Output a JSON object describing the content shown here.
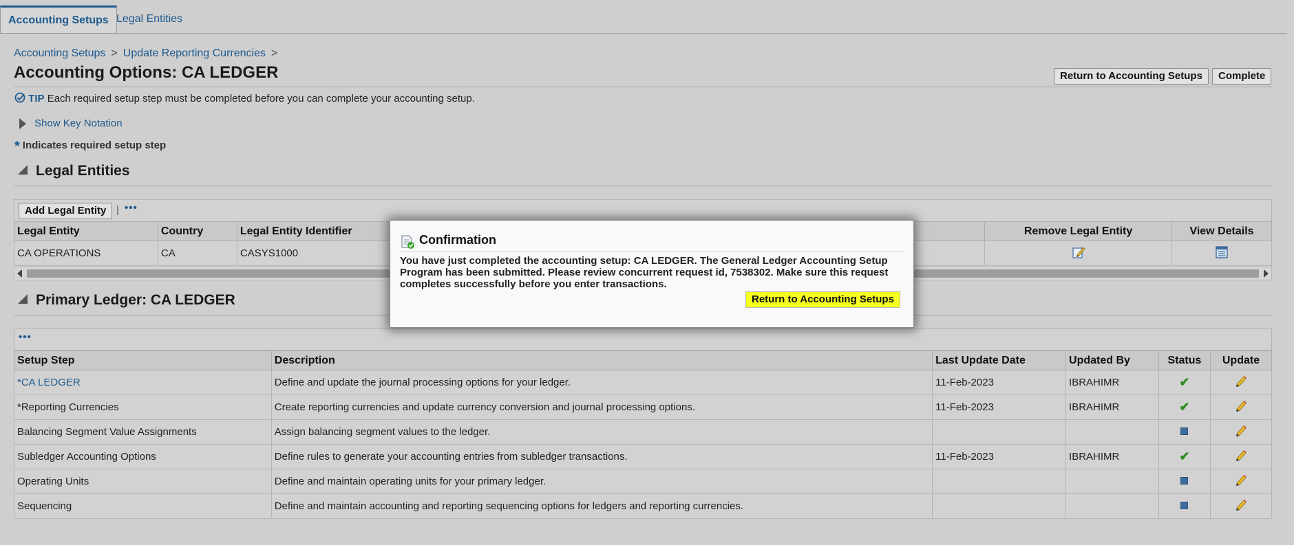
{
  "tabs": [
    {
      "label": "Accounting Setups",
      "active": true
    },
    {
      "label": "Legal Entities",
      "active": false
    }
  ],
  "breadcrumb": {
    "items": [
      "Accounting Setups",
      "Update Reporting Currencies"
    ],
    "separator": ">"
  },
  "page_title": "Accounting Options: CA LEDGER",
  "header_buttons": {
    "return": "Return to Accounting Setups",
    "complete": "Complete"
  },
  "tip": {
    "label": "TIP",
    "text": "Each required setup step must be completed before you can complete your accounting setup."
  },
  "key_notation": "Show Key Notation",
  "required_note": {
    "star": "*",
    "text": "Indicates required setup step"
  },
  "legal_entities": {
    "section_title": "Legal Entities",
    "add_button": "Add Legal Entity",
    "separator": "|",
    "more_icon": "•••",
    "columns": [
      "Legal Entity",
      "Country",
      "Legal Entity Identifier",
      "Remove Legal Entity",
      "View Details"
    ],
    "rows": [
      {
        "entity": "CA OPERATIONS",
        "country": "CA",
        "identifier": "CASYS1000"
      }
    ]
  },
  "primary_ledger": {
    "section_title": "Primary Ledger: CA LEDGER",
    "more_icon": "•••",
    "columns": [
      "Setup Step",
      "Description",
      "Last Update Date",
      "Updated By",
      "Status",
      "Update"
    ],
    "rows": [
      {
        "step": "*CA LEDGER",
        "link": true,
        "description": "Define and update the journal processing options for your ledger.",
        "date": "11-Feb-2023",
        "by": "IBRAHIMR",
        "status": "complete"
      },
      {
        "step": "*Reporting Currencies",
        "link": false,
        "description": "Create reporting currencies and update currency conversion and journal processing options.",
        "date": "11-Feb-2023",
        "by": "IBRAHIMR",
        "status": "complete"
      },
      {
        "step": "Balancing Segment Value Assignments",
        "link": false,
        "description": "Assign balancing segment values to the ledger.",
        "date": "",
        "by": "",
        "status": "not-started"
      },
      {
        "step": "Subledger Accounting Options",
        "link": false,
        "description": "Define rules to generate your accounting entries from subledger transactions.",
        "date": "11-Feb-2023",
        "by": "IBRAHIMR",
        "status": "complete"
      },
      {
        "step": "Operating Units",
        "link": false,
        "description": "Define and maintain operating units for your primary ledger.",
        "date": "",
        "by": "",
        "status": "not-started"
      },
      {
        "step": "Sequencing",
        "link": false,
        "description": "Define and maintain accounting and reporting sequencing options for ledgers and reporting currencies.",
        "date": "",
        "by": "",
        "status": "not-started"
      }
    ]
  },
  "confirmation": {
    "title": "Confirmation",
    "message": "You have just completed the accounting setup: CA LEDGER. The General Ledger Accounting Setup Program has been submitted. Please review concurrent request id, 7538302. Make sure this request completes successfully before you enter transactions.",
    "button": "Return to Accounting Setups"
  },
  "colors": {
    "link": "#1d5a8e",
    "highlight": "#f5ff20",
    "check": "#2e8b22",
    "background": "#cfcfcf"
  }
}
